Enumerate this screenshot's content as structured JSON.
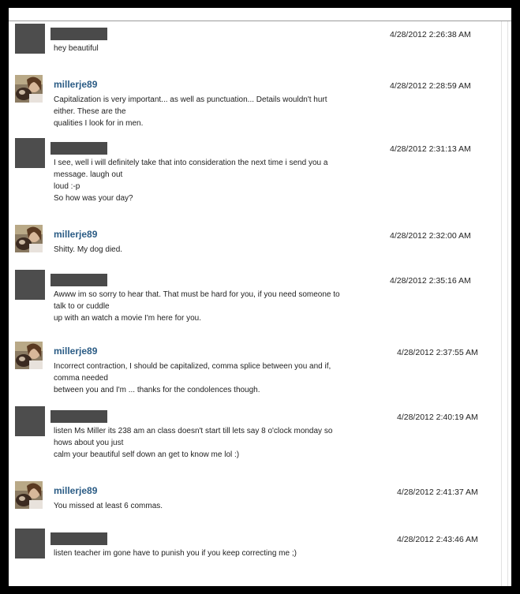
{
  "messages": [
    {
      "sender": "",
      "redacted": true,
      "time": "4/28/2012 2:26:38 AM",
      "lines": [
        "hey beautiful"
      ]
    },
    {
      "sender": "millerje89",
      "redacted": false,
      "time": "4/28/2012 2:28:59 AM",
      "lines": [
        "Capitalization is very important... as well as punctuation... Details wouldn't hurt",
        "either. These are the",
        "qualities I look for in men."
      ]
    },
    {
      "sender": "",
      "redacted": true,
      "time": "4/28/2012 2:31:13 AM",
      "lines": [
        "I see, well i will definitely take that into consideration the next time i send you a",
        "message. laugh out",
        "loud :-p",
        "So how was your day?"
      ]
    },
    {
      "sender": "millerje89",
      "redacted": false,
      "time": "4/28/2012 2:32:00 AM",
      "lines": [
        "Shitty. My dog died."
      ]
    },
    {
      "sender": "",
      "redacted": true,
      "time": "4/28/2012 2:35:16 AM",
      "lines": [
        "Awww im so sorry to hear that. That must be hard for you, if you need someone to",
        "talk to or cuddle",
        "up with an watch a movie I'm here for you."
      ]
    },
    {
      "sender": "millerje89",
      "redacted": false,
      "time": "4/28/2012 2:37:55 AM",
      "lines": [
        "Incorrect contraction, I should be capitalized, comma splice between you and if,",
        "comma needed",
        "between you and I'm ... thanks for the condolences though."
      ]
    },
    {
      "sender": "",
      "redacted": true,
      "time": "4/28/2012 2:40:19 AM",
      "lines": [
        "listen Ms Miller its 238 am an class doesn't start till lets say 8 o'clock monday so",
        "hows about you just",
        "calm your beautiful self down an get to know me lol :)"
      ]
    },
    {
      "sender": "millerje89",
      "redacted": false,
      "time": "4/28/2012 2:41:37 AM",
      "lines": [
        "You missed at least 6 commas."
      ]
    },
    {
      "sender": "",
      "redacted": true,
      "time": "4/28/2012 2:43:46 AM",
      "lines": [
        "listen teacher im gone have to punish you if you keep correcting me ;)"
      ]
    }
  ]
}
